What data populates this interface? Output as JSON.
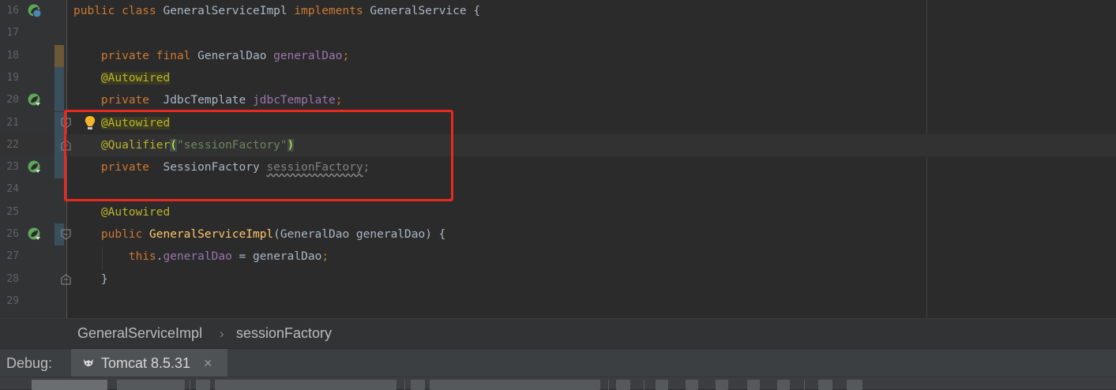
{
  "editor": {
    "lines": [
      {
        "num": "16",
        "tokens": [
          {
            "t": "public class ",
            "c": "kw"
          },
          {
            "t": "GeneralServiceImpl ",
            "c": ""
          },
          {
            "t": "implements ",
            "c": "kw"
          },
          {
            "t": "GeneralService {",
            "c": ""
          }
        ]
      },
      {
        "num": "17",
        "tokens": []
      },
      {
        "num": "18",
        "tokens": [
          {
            "t": "    private final ",
            "c": "kw"
          },
          {
            "t": "GeneralDao ",
            "c": ""
          },
          {
            "t": "generalDao",
            "c": "field"
          },
          {
            "t": ";",
            "c": "kw"
          }
        ]
      },
      {
        "num": "19",
        "tokens": [
          {
            "t": "    ",
            "c": ""
          },
          {
            "t": "@Autowired",
            "c": "ann ann-hl"
          }
        ]
      },
      {
        "num": "20",
        "tokens": [
          {
            "t": "    private  ",
            "c": "kw"
          },
          {
            "t": "JdbcTemplate ",
            "c": ""
          },
          {
            "t": "jdbcTemplate",
            "c": "field"
          },
          {
            "t": ";",
            "c": "kw"
          }
        ]
      },
      {
        "num": "21",
        "tokens": [
          {
            "t": "    ",
            "c": ""
          },
          {
            "t": "@Autowired",
            "c": "ann ann-hl"
          }
        ]
      },
      {
        "num": "22",
        "tokens": [
          {
            "t": "    ",
            "c": ""
          },
          {
            "t": "@Qualifier",
            "c": "ann"
          },
          {
            "t": "(",
            "c": "paren-hl"
          },
          {
            "t": "\"sessionFactory\"",
            "c": "str"
          },
          {
            "t": ")",
            "c": "paren-hl"
          }
        ]
      },
      {
        "num": "23",
        "tokens": [
          {
            "t": "    private  ",
            "c": "kw"
          },
          {
            "t": "SessionFactory ",
            "c": ""
          },
          {
            "t": "sessionFactory",
            "c": "muted squiggle"
          },
          {
            "t": ";",
            "c": "muted"
          }
        ]
      },
      {
        "num": "24",
        "tokens": []
      },
      {
        "num": "25",
        "tokens": [
          {
            "t": "    ",
            "c": ""
          },
          {
            "t": "@Autowired",
            "c": "ann"
          }
        ]
      },
      {
        "num": "26",
        "tokens": [
          {
            "t": "    public ",
            "c": "kw"
          },
          {
            "t": "GeneralServiceImpl",
            "c": "method"
          },
          {
            "t": "(GeneralDao generalDao) {",
            "c": ""
          }
        ]
      },
      {
        "num": "27",
        "tokens": [
          {
            "t": "        this",
            "c": "kw"
          },
          {
            "t": ".",
            "c": ""
          },
          {
            "t": "generalDao",
            "c": "field"
          },
          {
            "t": " = generalDao",
            "c": ""
          },
          {
            "t": ";",
            "c": "kw"
          }
        ]
      },
      {
        "num": "28",
        "tokens": [
          {
            "t": "    }",
            "c": ""
          }
        ]
      },
      {
        "num": "29",
        "tokens": []
      }
    ],
    "current_line": "22"
  },
  "icons": {
    "bean": "spring-bean-icon",
    "class": "class-icon",
    "fold": "fold-marker-icon",
    "bulb": "intention-bulb-icon",
    "tomcat": "tomcat-icon",
    "close": "close-icon"
  },
  "colors": {
    "highlight_box": "#e8291f",
    "keyword": "#cc7832",
    "annotation": "#bbb529",
    "field": "#9876aa",
    "string": "#6a8759"
  },
  "breadcrumb": {
    "items": [
      "GeneralServiceImpl",
      "sessionFactory"
    ],
    "separator": "›"
  },
  "debug": {
    "label": "Debug:",
    "tab_label": "Tomcat 8.5.31",
    "close_glyph": "×"
  }
}
